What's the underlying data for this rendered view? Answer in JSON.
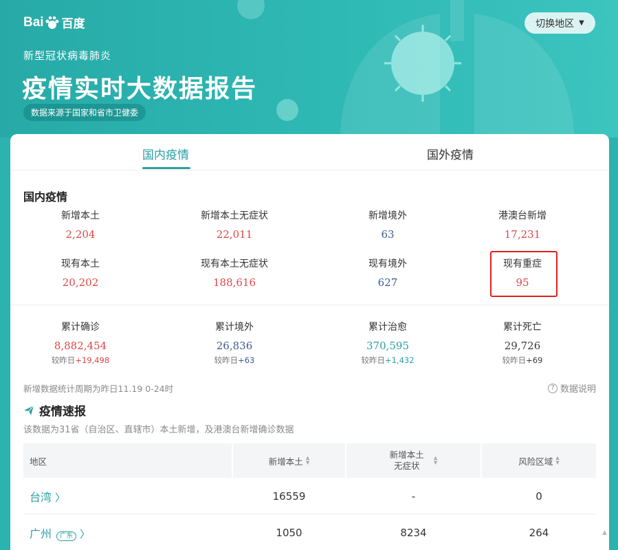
{
  "brand": {
    "logo_latin_1": "Bai",
    "logo_latin_2": "du",
    "logo_cn": "百度"
  },
  "header": {
    "switch_region_label": "切换地区",
    "subtitle": "新型冠状病毒肺炎",
    "title": "疫情实时大数据报告",
    "source_note": "数据来源于国家和省市卫健委"
  },
  "tabs": [
    {
      "label": "国内疫情",
      "active": true
    },
    {
      "label": "国外疫情",
      "active": false
    }
  ],
  "domestic": {
    "section_title": "国内疫情",
    "row1": [
      {
        "label": "新增本土",
        "value": "2,204",
        "color": "#e04545"
      },
      {
        "label": "新增本土无症状",
        "value": "22,011",
        "color": "#e04545"
      },
      {
        "label": "新增境外",
        "value": "63",
        "color": "#3b5a92"
      },
      {
        "label": "港澳台新增",
        "value": "17,231",
        "color": "#e04545"
      }
    ],
    "row2": [
      {
        "label": "现有本土",
        "value": "20,202",
        "color": "#e04545"
      },
      {
        "label": "现有本土无症状",
        "value": "188,616",
        "color": "#e04545"
      },
      {
        "label": "现有境外",
        "value": "627",
        "color": "#3b5a92"
      },
      {
        "label": "现有重症",
        "value": "95",
        "color": "#e04545"
      }
    ],
    "cumulative": [
      {
        "label": "累计确诊",
        "value": "8,882,454",
        "cmp_prefix": "较昨日",
        "cmp_value": "+19,498",
        "color": "#e04545"
      },
      {
        "label": "累计境外",
        "value": "26,836",
        "cmp_prefix": "较昨日",
        "cmp_value": "+63",
        "color": "#3b5a92"
      },
      {
        "label": "累计治愈",
        "value": "370,595",
        "cmp_prefix": "较昨日",
        "cmp_value": "+1,432",
        "color": "#2a9fa3"
      },
      {
        "label": "累计死亡",
        "value": "29,726",
        "cmp_prefix": "较昨日",
        "cmp_value": "+69",
        "color": "#3a3a3a"
      }
    ],
    "period_note": "新增数据统计周期为昨日11.19 0-24时",
    "help_label": "数据说明"
  },
  "brief": {
    "title": "疫情速报",
    "desc": "该数据为31省（自治区、直辖市）本土新增，及港澳台新增确诊数据",
    "columns": {
      "region": "地区",
      "new_local": "新增本土",
      "new_asym_1": "新增本土",
      "new_asym_2": "无症状",
      "risk": "风险区域"
    },
    "rows": [
      {
        "region": "台湾",
        "tag": "",
        "new_local": "16559",
        "new_asym": "-",
        "risk": "0",
        "risk_color": "#333333"
      },
      {
        "region": "广州",
        "tag": "广东",
        "new_local": "1050",
        "new_asym": "8234",
        "risk": "264",
        "risk_color": "#e04545"
      }
    ]
  },
  "colors": {
    "accent": "#2a9fa3",
    "banner": "#2cb3b0",
    "increase": "#e04545",
    "highlight_box": "#e01e1e"
  }
}
